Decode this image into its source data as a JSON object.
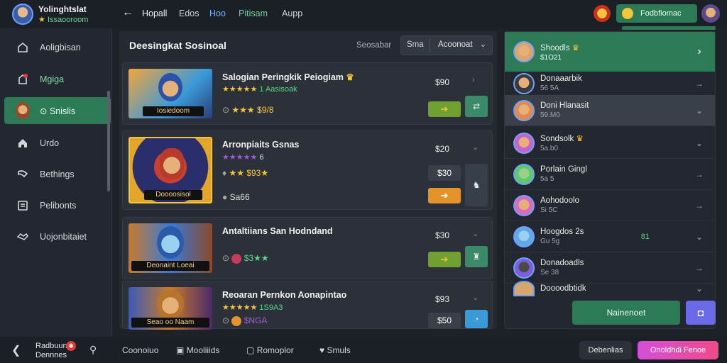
{
  "profile": {
    "name": "Yolinghtslat",
    "sub": "Issaooroom",
    "star": "★"
  },
  "sidebar": {
    "items": [
      {
        "label": "Aoligbisan",
        "icon": "home-icon"
      },
      {
        "label": "Mgiga",
        "icon": "notification-icon"
      },
      {
        "label": "Snislis",
        "icon": "avatar-icon",
        "active": true
      },
      {
        "label": "Urdo",
        "icon": "house-icon"
      },
      {
        "label": "Bethings",
        "icon": "settings-icon"
      },
      {
        "label": "Pelibonts",
        "icon": "document-icon"
      },
      {
        "label": "Uojonbitaiet",
        "icon": "handshake-icon"
      }
    ],
    "footer": {
      "line1": "Radbuun",
      "line2": "Dennnes",
      "icon": "back-icon"
    }
  },
  "topbar": {
    "tabs": [
      "Hopall",
      "Edos",
      "Hoo",
      "Pitisam",
      "Aupp"
    ],
    "alert_label": "Fodbfiomac"
  },
  "main": {
    "title": "Deesingkat Sosinoal",
    "sort_label": "Seosabar",
    "seg_a": "Sma",
    "seg_b": "Acoonoat",
    "cards": [
      {
        "title": "Salogian Peringkik Peiogiam",
        "stars_text": "★★★★★",
        "stars_suffix": "1 Aasisoak",
        "tag": "★★★ $9/8",
        "price": "$90",
        "thumb_caption": "Iosiedoom",
        "buy_icon": "arrow-icon"
      },
      {
        "title": "Arronpiaits Gsnas",
        "stars_text": "★★★★★",
        "stars_suffix": "6",
        "tag": "★★ $93★",
        "tag2": "Sa66",
        "price": "$20",
        "price2": "$30",
        "thumb_caption": "Doooosisol",
        "buy_icon": "arrow-icon"
      },
      {
        "title": "Antaltiians San Hodndand",
        "stars_text": "★★★★★",
        "stars_suffix": "",
        "tag": "$3★★",
        "price": "$30",
        "thumb_caption": "Deonaint Loeai",
        "buy_icon": "arrow-icon"
      },
      {
        "title": "Reoaran Pernkon Aonapintao",
        "stars_text": "★★★★★",
        "stars_suffix": "1S9A3",
        "tag": "$NGA",
        "price": "$93",
        "price2": "$50",
        "thumb_caption": "Seao oo Naam",
        "buy_icon": "arrow-icon"
      }
    ]
  },
  "right": {
    "items": [
      {
        "name": "Shoodls",
        "sub": "$1O21",
        "color": "#d8a66a",
        "highlight": true
      },
      {
        "name": "Donaaarbik",
        "sub": "56 5A",
        "color": "#8fa8d8"
      },
      {
        "name": "Doni Hlanasit",
        "sub": "59.M0",
        "color": "#e08a52",
        "active": true
      },
      {
        "name": "Sondsolk",
        "sub": "5a.b0",
        "color": "#c464c8"
      },
      {
        "name": "Porlain Gingl",
        "sub": "5a 5",
        "color": "#5ec86a"
      },
      {
        "name": "Aohodoolo",
        "sub": "Si 5C",
        "color": "#d76cc0"
      },
      {
        "name": "Hoogdos 2s",
        "sub": "Gu 5g",
        "color": "#60a8e8",
        "extra": "81"
      },
      {
        "name": "Donadoadls",
        "sub": "Se 38",
        "color": "#7c60d8"
      },
      {
        "name": "Doooodbtidk",
        "sub": "",
        "color": "#d8a66a"
      }
    ],
    "primary_button": "Nainenoet"
  },
  "bottombar": {
    "items": [
      "Coonoiuo",
      "Mooliiids",
      "Romoplor",
      "Smuls"
    ],
    "right_a": "Debenlias",
    "right_b": "Onoldhdi Fenoe"
  }
}
